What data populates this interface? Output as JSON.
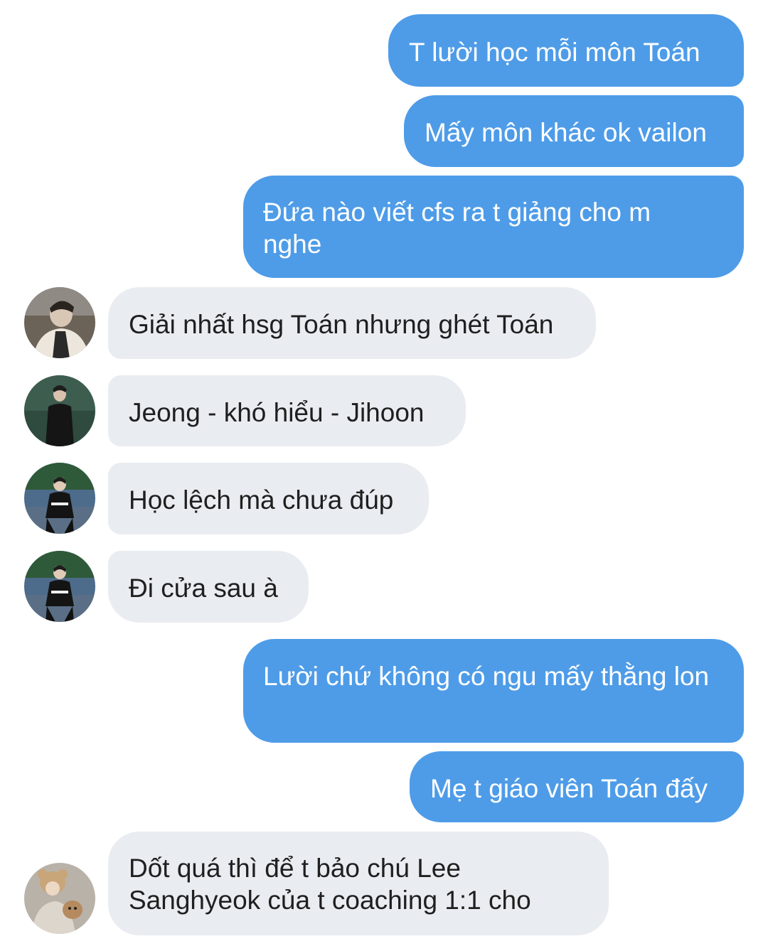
{
  "messages": [
    {
      "side": "sent",
      "text": "T lười học mỗi môn Toán"
    },
    {
      "side": "sent",
      "text": "Mấy môn khác ok vailon"
    },
    {
      "side": "sent",
      "text": "Đứa nào viết cfs ra t giảng cho m nghe"
    },
    {
      "side": "received",
      "text": "Giải nhất hsg Toán nhưng ghét Toán"
    },
    {
      "side": "received",
      "text": "Jeong - khó hiểu - Jihoon"
    },
    {
      "side": "received",
      "text": "Học lệch mà chưa đúp"
    },
    {
      "side": "received",
      "text": "Đi cửa sau à"
    },
    {
      "side": "sent",
      "text": "Lười chứ không có ngu mấy thằng lon"
    },
    {
      "side": "sent",
      "text": "Mẹ t giáo viên Toán đấy"
    },
    {
      "side": "received",
      "text": "Dốt quá thì để t bảo chú Lee Sanghyeok của t coaching 1:1 cho"
    }
  ],
  "colors": {
    "sent_bubble": "#4e9ce8",
    "received_bubble": "#e9ecf0",
    "background": "#ffffff"
  }
}
